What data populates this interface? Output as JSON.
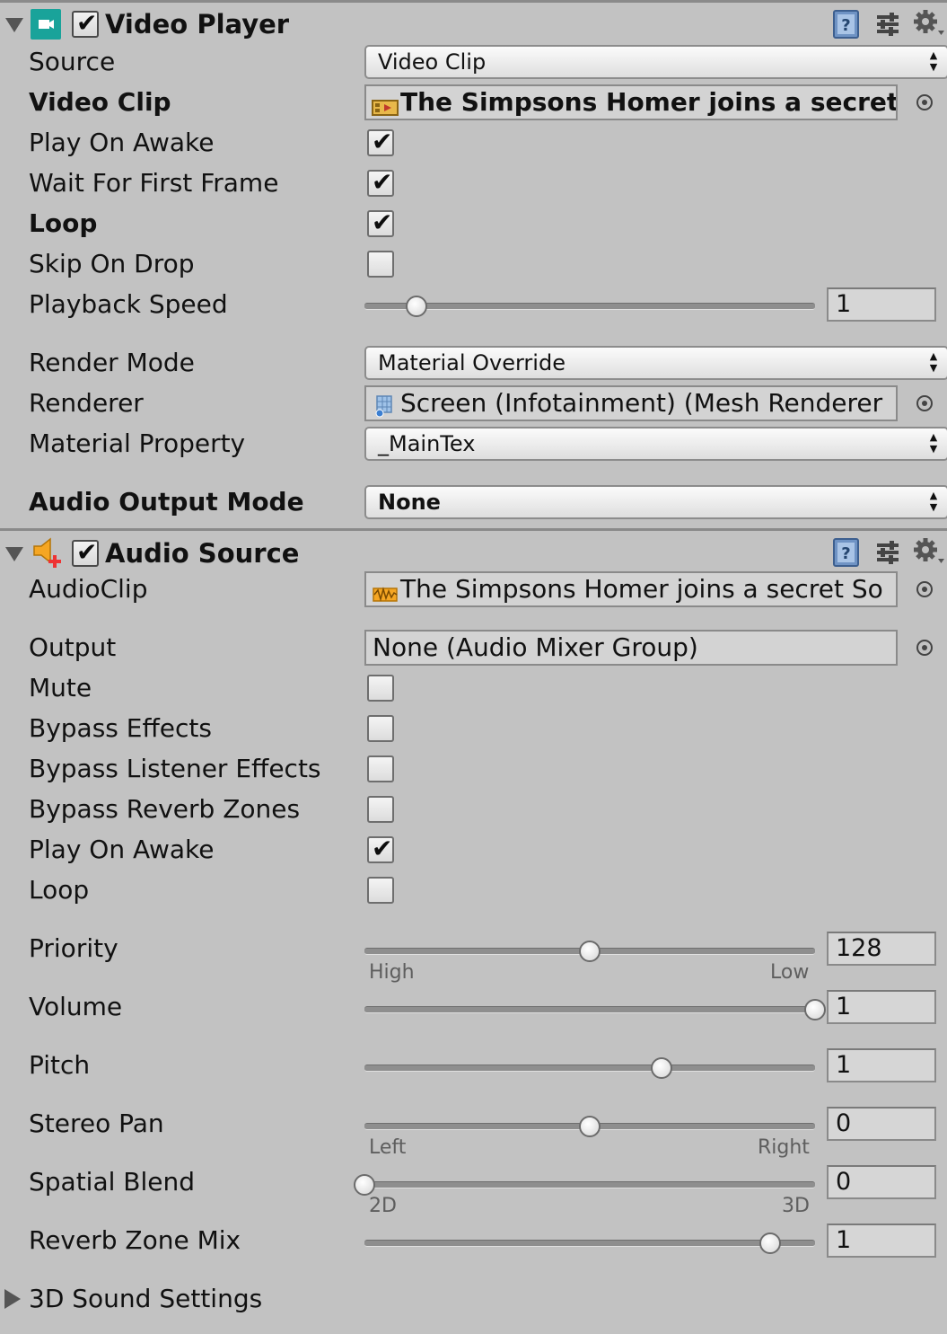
{
  "video_player": {
    "title": "Video Player",
    "enabled": true,
    "source": {
      "label": "Source",
      "value": "Video Clip"
    },
    "video_clip": {
      "label": "Video Clip",
      "value": "The Simpsons Homer joins a secret"
    },
    "play_on_awake": {
      "label": "Play On Awake",
      "checked": true
    },
    "wait_for_first_frame": {
      "label": "Wait For First Frame",
      "checked": true
    },
    "loop": {
      "label": "Loop",
      "checked": true
    },
    "skip_on_drop": {
      "label": "Skip On Drop",
      "checked": false
    },
    "playback_speed": {
      "label": "Playback Speed",
      "value": "1",
      "fraction": 0.115
    },
    "render_mode": {
      "label": "Render Mode",
      "value": "Material Override"
    },
    "renderer": {
      "label": "Renderer",
      "value": "Screen (Infotainment) (Mesh Renderer"
    },
    "material_property": {
      "label": "Material Property",
      "value": "_MainTex"
    },
    "audio_output_mode": {
      "label": "Audio Output Mode",
      "value": "None"
    }
  },
  "audio_source": {
    "title": "Audio Source",
    "enabled": true,
    "audio_clip": {
      "label": "AudioClip",
      "value": "The Simpsons Homer joins a secret So"
    },
    "output": {
      "label": "Output",
      "value": "None (Audio Mixer Group)"
    },
    "mute": {
      "label": "Mute",
      "checked": false
    },
    "bypass_effects": {
      "label": "Bypass Effects",
      "checked": false
    },
    "bypass_listener_effects": {
      "label": "Bypass Listener Effects",
      "checked": false
    },
    "bypass_reverb_zones": {
      "label": "Bypass Reverb Zones",
      "checked": false
    },
    "play_on_awake": {
      "label": "Play On Awake",
      "checked": true
    },
    "loop": {
      "label": "Loop",
      "checked": false
    },
    "priority": {
      "label": "Priority",
      "value": "128",
      "min_label": "High",
      "max_label": "Low",
      "fraction": 0.5
    },
    "volume": {
      "label": "Volume",
      "value": "1",
      "fraction": 1.0
    },
    "pitch": {
      "label": "Pitch",
      "value": "1",
      "fraction": 0.66
    },
    "stereo_pan": {
      "label": "Stereo Pan",
      "value": "0",
      "min_label": "Left",
      "max_label": "Right",
      "fraction": 0.5
    },
    "spatial_blend": {
      "label": "Spatial Blend",
      "value": "0",
      "min_label": "2D",
      "max_label": "3D",
      "fraction": 0.0
    },
    "reverb_zone_mix": {
      "label": "Reverb Zone Mix",
      "value": "1",
      "fraction": 0.9
    },
    "sound_3d_settings": {
      "label": "3D Sound Settings"
    }
  },
  "icons": {
    "video_player": "video-player-icon",
    "audio_source": "audio-source-icon",
    "help": "help-book-icon",
    "preset": "preset-sliders-icon",
    "settings": "gear-icon",
    "video_clip": "video-clip-icon",
    "mesh_renderer": "mesh-renderer-icon",
    "audio_clip": "audio-clip-icon"
  },
  "colors": {
    "panel_bg": "#c2c2c2",
    "video_icon": "#19a39a",
    "audio_icon": "#f5a623"
  }
}
